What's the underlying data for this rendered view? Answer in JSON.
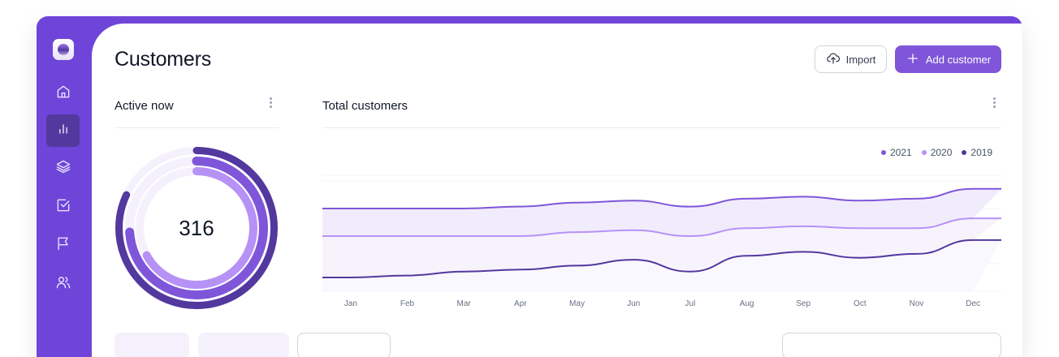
{
  "page": {
    "title": "Customers"
  },
  "actions": {
    "import_label": "Import",
    "add_label": "Add customer"
  },
  "colors": {
    "brand": "#7f56d9",
    "brand_dark": "#53389e",
    "brand_light": "#b692f6"
  },
  "sidebar": {
    "items": [
      {
        "name": "home",
        "icon": "home-icon"
      },
      {
        "name": "dashboard",
        "icon": "bar-chart-icon",
        "active": true
      },
      {
        "name": "projects",
        "icon": "layers-icon"
      },
      {
        "name": "tasks",
        "icon": "check-square-icon"
      },
      {
        "name": "reporting",
        "icon": "flag-icon"
      },
      {
        "name": "users",
        "icon": "users-icon"
      }
    ]
  },
  "active_now": {
    "title": "Active now",
    "value": "316",
    "rings": [
      0.82,
      0.74,
      0.67
    ]
  },
  "total_customers": {
    "title": "Total customers"
  },
  "chart_data": {
    "type": "area",
    "title": "Total customers",
    "x": [
      "Jan",
      "Feb",
      "Mar",
      "Apr",
      "May",
      "Jun",
      "Jul",
      "Aug",
      "Sep",
      "Oct",
      "Nov",
      "Dec"
    ],
    "series": [
      {
        "name": "2021",
        "color": "#7f56d9",
        "values": [
          72,
          72,
          72,
          73,
          75,
          76,
          73,
          77,
          78,
          76,
          77,
          82
        ]
      },
      {
        "name": "2020",
        "color": "#b692f6",
        "values": [
          58,
          58,
          58,
          58,
          60,
          61,
          58,
          62,
          63,
          62,
          62,
          67
        ]
      },
      {
        "name": "2019",
        "color": "#53389e",
        "values": [
          37,
          38,
          40,
          41,
          43,
          46,
          40,
          48,
          50,
          47,
          49,
          56
        ]
      }
    ],
    "ylim": [
      30,
      100
    ],
    "grid": true,
    "legend": "top-right"
  }
}
